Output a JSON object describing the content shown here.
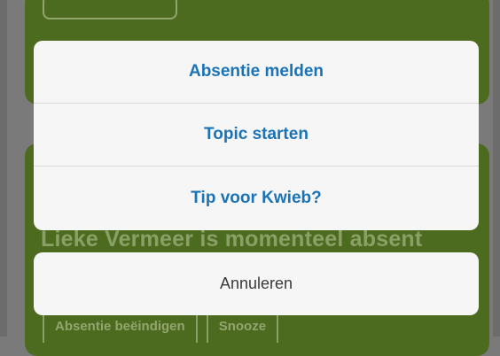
{
  "background": {
    "status_text": "Lieke Vermeer is momenteel absent",
    "actions": [
      "Absentie beëindigen",
      "Snooze"
    ]
  },
  "action_sheet": {
    "options": [
      "Absentie melden",
      "Topic starten",
      "Tip voor Kwieb?"
    ],
    "cancel_label": "Annuleren"
  },
  "colors": {
    "accent": "#1b73b6",
    "card_green": "#4d6b1f",
    "sheet_background": "#f6f6f6"
  }
}
